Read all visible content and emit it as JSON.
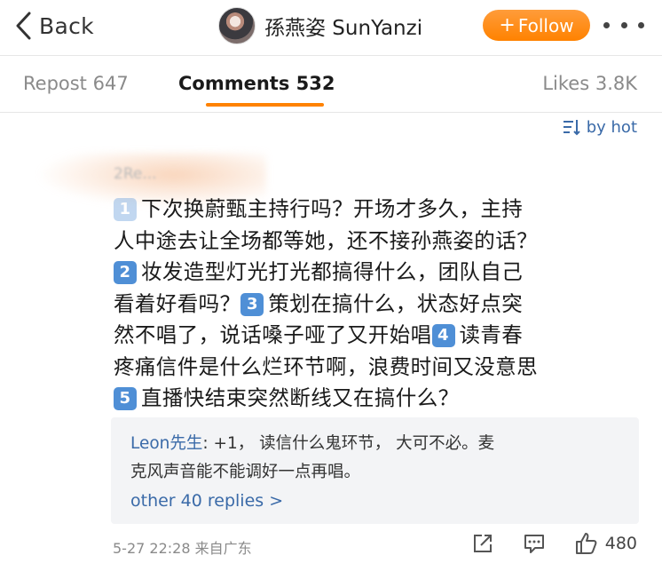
{
  "nav": {
    "back_label": "Back",
    "profile_name": "孫燕姿 SunYanzi",
    "follow_label": "Follow",
    "follow_plus": "+",
    "accent": "#ff8200",
    "more_icon": "more-dots-icon"
  },
  "tabs": {
    "repost": "Repost 647",
    "comments": "Comments 532",
    "likes": "Likes 3.8K"
  },
  "sort": {
    "label": "by hot",
    "icon": "sort-icon"
  },
  "comment": {
    "user": "2Re...",
    "lines": [
      {
        "num": "1",
        "text": "下次换蔚甄主持行吗？开场才多久，主持"
      },
      {
        "num": "",
        "text": "人中途去让全场都等她，还不接孙燕姿的话？"
      },
      {
        "num": "2",
        "text": "妆发造型灯光打光都搞得什么，团队自己"
      },
      {
        "num": "",
        "text": "看着好看吗？",
        "num2": "3",
        "text2": "策划在搞什么，状态好点突"
      },
      {
        "num": "",
        "text": "然不唱了，说话嗓子哑了又开始唱",
        "num2": "4",
        "text2": "读青春"
      },
      {
        "num": "",
        "text": "疼痛信件是什么烂环节啊，浪费时间又没意思"
      },
      {
        "num": "5",
        "text": "直播快结束突然断线又在搞什么？"
      }
    ]
  },
  "replies": {
    "user": "Leon先生",
    "text_line1": ": +1， 读信什么鬼环节， 大可不必。麦",
    "text_line2": "克风声音能不能调好一点再唱。",
    "more_label": "other 40 replies >"
  },
  "meta": {
    "time": "5-27 22:28",
    "source": "来自广东"
  },
  "actions": {
    "like_count": "480"
  }
}
